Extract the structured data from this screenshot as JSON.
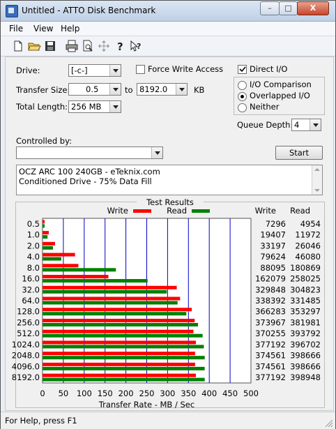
{
  "window": {
    "title": "Untitled - ATTO Disk Benchmark",
    "buttons": [
      "–",
      "□",
      "X"
    ]
  },
  "menu": [
    {
      "label": "File"
    },
    {
      "label": "View"
    },
    {
      "label": "Help"
    }
  ],
  "toolbar": [
    {
      "icon": "new-file-icon"
    },
    {
      "icon": "open-folder-icon"
    },
    {
      "icon": "save-disk-icon"
    },
    {
      "icon": "printer-icon"
    },
    {
      "icon": "print-preview-icon"
    },
    {
      "icon": "move-arrows-icon"
    },
    {
      "icon": "help-question-icon"
    },
    {
      "icon": "context-help-icon"
    }
  ],
  "settings": {
    "drive_label": "Drive:",
    "drive_value": "[-c-]",
    "force_write_label": "Force Write Access",
    "direct_io_label": "Direct I/O",
    "transfer_size_label": "Transfer Size:",
    "transfer_from": "0.5",
    "to_label": "to",
    "transfer_to": "8192.0",
    "kb_label": "KB",
    "total_length_label": "Total Length:",
    "total_length_value": "256 MB",
    "io_comparison_label": "I/O Comparison",
    "overlapped_io_label": "Overlapped I/O",
    "neither_label": "Neither",
    "queue_depth_label": "Queue Depth:",
    "queue_depth_value": "4",
    "controlled_by_label": "Controlled by:",
    "controlled_by_value": "",
    "start_label": "Start"
  },
  "description": [
    "OCZ ARC 100 240GB - eTeknix.com",
    "Conditioned Drive - 75% Data Fill"
  ],
  "status": {
    "text": "For Help, press F1"
  },
  "chart_data": {
    "type": "bar",
    "title": "Test Results",
    "xlabel": "Transfer Rate - MB / Sec",
    "xlim": [
      0,
      500
    ],
    "xticks": [
      0,
      50,
      100,
      150,
      200,
      250,
      300,
      350,
      400,
      450,
      500
    ],
    "categories": [
      "0.5",
      "1.0",
      "2.0",
      "4.0",
      "8.0",
      "16.0",
      "32.0",
      "64.0",
      "128.0",
      "256.0",
      "512.0",
      "1024.0",
      "2048.0",
      "4096.0",
      "8192.0"
    ],
    "series": [
      {
        "name": "Write",
        "color": "#ff0000",
        "values": [
          5,
          15,
          30,
          78,
          86,
          158,
          322,
          330,
          358,
          365,
          362,
          368,
          366,
          366,
          368
        ]
      },
      {
        "name": "Read",
        "color": "#008000",
        "values": [
          5,
          12,
          25,
          45,
          176,
          252,
          298,
          324,
          345,
          373,
          384,
          387,
          389,
          389,
          389
        ]
      }
    ],
    "table_headers": {
      "write": "Write",
      "read": "Read"
    },
    "write_kbps": [
      "7296",
      "19407",
      "33197",
      "79624",
      "88095",
      "162079",
      "329848",
      "338392",
      "366283",
      "373967",
      "370255",
      "377192",
      "374561",
      "374561",
      "377192"
    ],
    "read_kbps": [
      "4954",
      "11972",
      "26046",
      "46080",
      "180869",
      "258025",
      "304823",
      "331485",
      "353297",
      "381981",
      "393792",
      "396702",
      "398666",
      "398666",
      "398948"
    ],
    "grid": true,
    "legend": "top"
  }
}
